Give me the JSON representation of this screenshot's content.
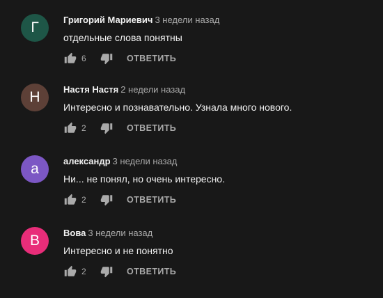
{
  "comments": [
    {
      "avatar_letter": "Г",
      "avatar_color": "#1e5647",
      "author": "Григорий Мариевич",
      "time": "3 недели назад",
      "text": "отдельные слова понятны",
      "likes": "6",
      "reply_label": "ОТВЕТИТЬ",
      "like_icon": "thumb-up-icon",
      "dislike_icon": "thumb-down-icon"
    },
    {
      "avatar_letter": "Н",
      "avatar_color": "#5d4037",
      "author": "Настя Настя",
      "time": "2 недели назад",
      "text": "Интересно и познавательно. Узнала много нового.",
      "likes": "2",
      "reply_label": "ОТВЕТИТЬ",
      "like_icon": "thumb-up-icon",
      "dislike_icon": "thumb-down-icon"
    },
    {
      "avatar_letter": "а",
      "avatar_color": "#7c57c4",
      "author": "александр",
      "time": "3 недели назад",
      "text": "Ни... не понял, но очень интересно.",
      "likes": "2",
      "reply_label": "ОТВЕТИТЬ",
      "like_icon": "thumb-up-icon",
      "dislike_icon": "thumb-down-icon"
    },
    {
      "avatar_letter": "В",
      "avatar_color": "#e82d79",
      "author": "Вова",
      "time": "3 недели назад",
      "text": "Интересно и не понятно",
      "likes": "2",
      "reply_label": "ОТВЕТИТЬ",
      "like_icon": "thumb-up-icon",
      "dislike_icon": "thumb-down-icon"
    }
  ],
  "colors": {
    "background": "#181818",
    "text_primary": "#f1f1f1",
    "text_secondary": "#aaaaaa"
  }
}
